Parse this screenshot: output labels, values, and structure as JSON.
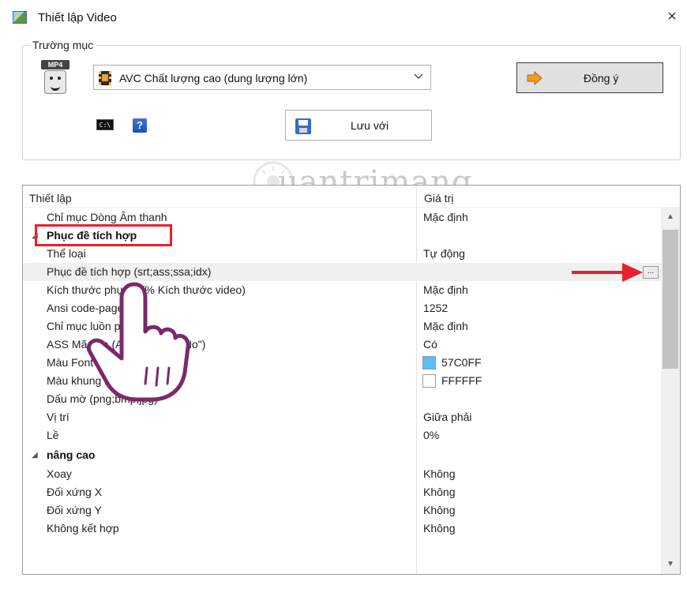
{
  "window": {
    "title": "Thiết lập Video",
    "close_symbol": "×"
  },
  "group": {
    "label": "Trường mục",
    "format_tag": "MP4",
    "profile_value": "AVC Chất lượng cao (dung lượng lớn)",
    "ok_label": "Đồng ý",
    "save_label": "Lưu với",
    "help_symbol": "?",
    "cmd_symbol": "C:\\"
  },
  "grid": {
    "col_setting": "Thiết lập",
    "col_value": "Giá trị",
    "rows": [
      {
        "name": "Chỉ mục Dòng Âm thanh",
        "value": "Mặc định"
      },
      {
        "name": "Phục đề tích hợp",
        "category": true
      },
      {
        "name": "Thể loại",
        "value": "Tự động"
      },
      {
        "name": "Phục đề tích hợp (srt;ass;ssa;idx)",
        "value": "",
        "button": "..."
      },
      {
        "name": "Kích thước phụ đề (% Kích thước video)",
        "value": "Mặc định"
      },
      {
        "name": "Ansi code-page",
        "value": "1252"
      },
      {
        "name": "Chỉ mục luồn phụ đề",
        "value": "Mặc định"
      },
      {
        "name": "ASS Mã hóa (Arabic set to \"No\")",
        "value": "Có"
      },
      {
        "name": "Màu Font",
        "value": "57C0FF",
        "swatch": "#57C0FF"
      },
      {
        "name": "Màu khung Font",
        "value": "FFFFFF",
        "swatch": "#FFFFFF"
      },
      {
        "name": "Dấu mờ (png;bmp;jpg)",
        "value": ""
      },
      {
        "name": "Vị trí",
        "value": "Giữa phải"
      },
      {
        "name": "Lề",
        "value": "0%"
      },
      {
        "name": "nâng cao",
        "category": true
      },
      {
        "name": "Xoay",
        "value": "Không"
      },
      {
        "name": "Đối xứng X",
        "value": "Không"
      },
      {
        "name": "Đối xứng Y",
        "value": "Không"
      },
      {
        "name": "Không kết hợp",
        "value": "Không"
      }
    ]
  },
  "colors": {
    "highlight_red": "#e8202a",
    "font_color": "#57C0FF"
  },
  "watermark": {
    "text": "uantrimang"
  }
}
